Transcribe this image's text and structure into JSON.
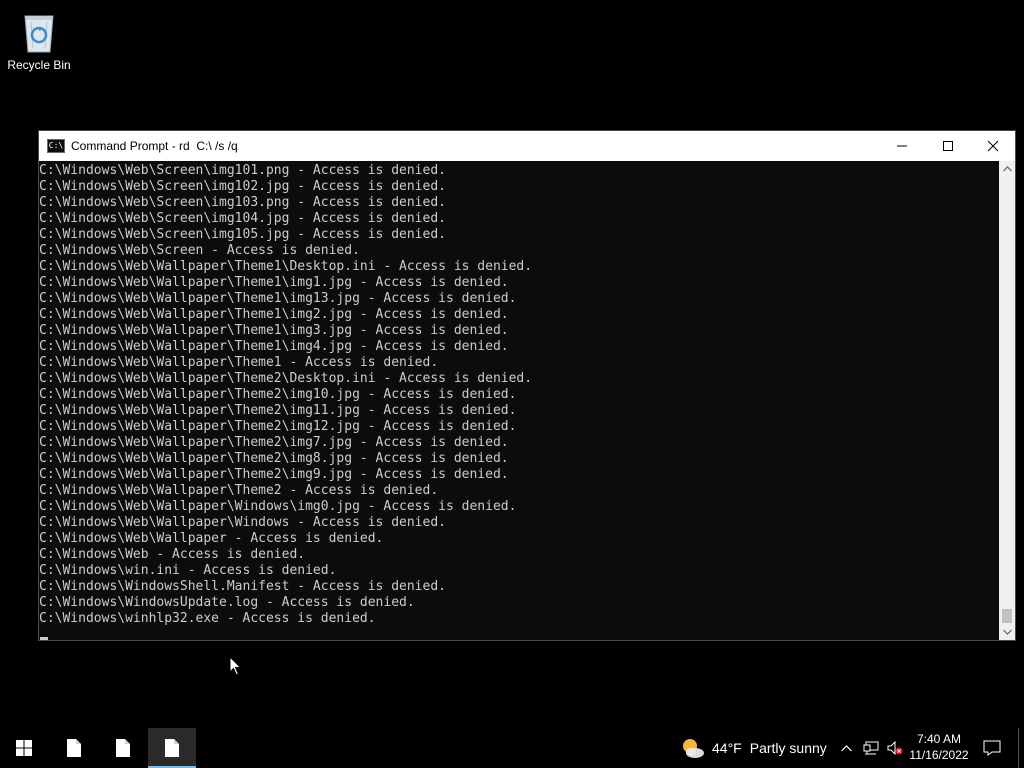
{
  "desktop": {
    "icons": [
      {
        "label": "Recycle Bin",
        "icon": "recycle-bin-icon"
      }
    ]
  },
  "window": {
    "title": "Command Prompt - rd  C:\\ /s /q",
    "app_icon": "cmd-icon",
    "app_icon_text": "C:\\",
    "controls": {
      "minimize": "minimize-icon",
      "maximize": "maximize-icon",
      "close": "close-icon"
    },
    "console_lines": [
      "C:\\Windows\\Web\\Screen\\img101.png - Access is denied.",
      "C:\\Windows\\Web\\Screen\\img102.jpg - Access is denied.",
      "C:\\Windows\\Web\\Screen\\img103.png - Access is denied.",
      "C:\\Windows\\Web\\Screen\\img104.jpg - Access is denied.",
      "C:\\Windows\\Web\\Screen\\img105.jpg - Access is denied.",
      "C:\\Windows\\Web\\Screen - Access is denied.",
      "C:\\Windows\\Web\\Wallpaper\\Theme1\\Desktop.ini - Access is denied.",
      "C:\\Windows\\Web\\Wallpaper\\Theme1\\img1.jpg - Access is denied.",
      "C:\\Windows\\Web\\Wallpaper\\Theme1\\img13.jpg - Access is denied.",
      "C:\\Windows\\Web\\Wallpaper\\Theme1\\img2.jpg - Access is denied.",
      "C:\\Windows\\Web\\Wallpaper\\Theme1\\img3.jpg - Access is denied.",
      "C:\\Windows\\Web\\Wallpaper\\Theme1\\img4.jpg - Access is denied.",
      "C:\\Windows\\Web\\Wallpaper\\Theme1 - Access is denied.",
      "C:\\Windows\\Web\\Wallpaper\\Theme2\\Desktop.ini - Access is denied.",
      "C:\\Windows\\Web\\Wallpaper\\Theme2\\img10.jpg - Access is denied.",
      "C:\\Windows\\Web\\Wallpaper\\Theme2\\img11.jpg - Access is denied.",
      "C:\\Windows\\Web\\Wallpaper\\Theme2\\img12.jpg - Access is denied.",
      "C:\\Windows\\Web\\Wallpaper\\Theme2\\img7.jpg - Access is denied.",
      "C:\\Windows\\Web\\Wallpaper\\Theme2\\img8.jpg - Access is denied.",
      "C:\\Windows\\Web\\Wallpaper\\Theme2\\img9.jpg - Access is denied.",
      "C:\\Windows\\Web\\Wallpaper\\Theme2 - Access is denied.",
      "C:\\Windows\\Web\\Wallpaper\\Windows\\img0.jpg - Access is denied.",
      "C:\\Windows\\Web\\Wallpaper\\Windows - Access is denied.",
      "C:\\Windows\\Web\\Wallpaper - Access is denied.",
      "C:\\Windows\\Web - Access is denied.",
      "C:\\Windows\\win.ini - Access is denied.",
      "C:\\Windows\\WindowsShell.Manifest - Access is denied.",
      "C:\\Windows\\WindowsUpdate.log - Access is denied.",
      "C:\\Windows\\winhlp32.exe - Access is denied."
    ]
  },
  "taskbar": {
    "start_icon": "windows-start-icon",
    "pinned": [
      {
        "icon": "document-icon",
        "active": false
      },
      {
        "icon": "document-icon",
        "active": false
      },
      {
        "icon": "document-icon",
        "active": true
      }
    ],
    "weather": {
      "icon": "partly-sunny-icon",
      "temperature": "44°F",
      "condition": "Partly sunny"
    },
    "tray": {
      "chevron": "chevron-up-icon",
      "network": "network-icon",
      "volume": "volume-muted-icon"
    },
    "clock": {
      "time": "7:40 AM",
      "date": "11/16/2022"
    },
    "notifications_icon": "action-center-icon"
  },
  "colors": {
    "console_bg": "#0c0c0c",
    "console_text": "#cccccc",
    "titlebar_bg": "#ffffff",
    "taskbar_bg": "#000000",
    "active_indicator": "#76b9ed"
  }
}
